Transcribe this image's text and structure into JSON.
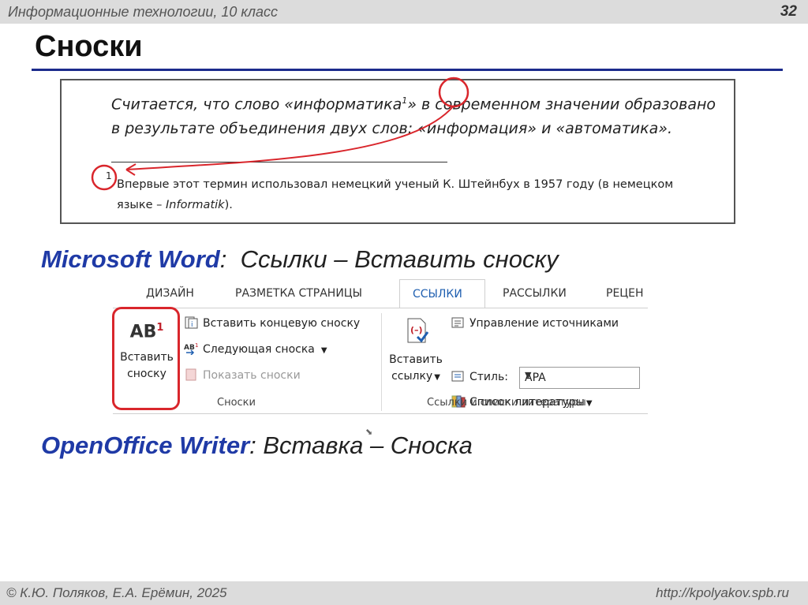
{
  "header": {
    "course": "Информационные технологии, 10 класс",
    "page_number": "32"
  },
  "title": "Сноски",
  "example": {
    "paragraph_before": "Считается, что слово «информатика",
    "footnote_ref": "1",
    "paragraph_after": "» в современном значении образовано в результате объединения двух слов: «информация» и «автоматика».",
    "footnote_num": "1",
    "footnote_text_before": "Впервые этот термин использовал немецкий ученый К. Штейнбух в 1957 году (в немецком языке – ",
    "footnote_text_term": "Informatik",
    "footnote_text_after": ")."
  },
  "word_line": {
    "app": "Microsoft Word",
    "sep": ":",
    "path": "  Ссылки – Вставить сноску"
  },
  "ribbon": {
    "tabs": [
      "ДИЗАЙН",
      "РАЗМЕТКА СТРАНИЦЫ",
      "ССЫЛКИ",
      "РАССЫЛКИ",
      "РЕЦЕН"
    ],
    "active_tab": "ССЫЛКИ",
    "insert_footnote": {
      "icon_text": "AB",
      "icon_sup": "1",
      "label_line1": "Вставить",
      "label_line2": "сноску"
    },
    "insert_endnote": "Вставить концевую сноску",
    "next_footnote": "Следующая сноска",
    "show_notes": "Показать сноски",
    "group_footnotes": "Сноски",
    "insert_citation": {
      "label_line1": "Вставить",
      "label_line2": "ссылку"
    },
    "manage_sources": "Управление источниками",
    "style_label": "Стиль:",
    "style_value": "APA",
    "bibliography": "Список литературы",
    "group_citations": "Ссылки и списки литературы"
  },
  "oo_line": {
    "app": "OpenOffice Writer",
    "sep": ":",
    "path": " Вставка – Сноска"
  },
  "footer": {
    "authors": "© К.Ю. Поляков, Е.А. Ерёмин, 2025",
    "url": "http://kpolyakov.spb.ru"
  },
  "colors": {
    "accent_blue": "#1f3aa6",
    "highlight_red": "#d9262c",
    "rule_blue": "#1c2b8c"
  }
}
